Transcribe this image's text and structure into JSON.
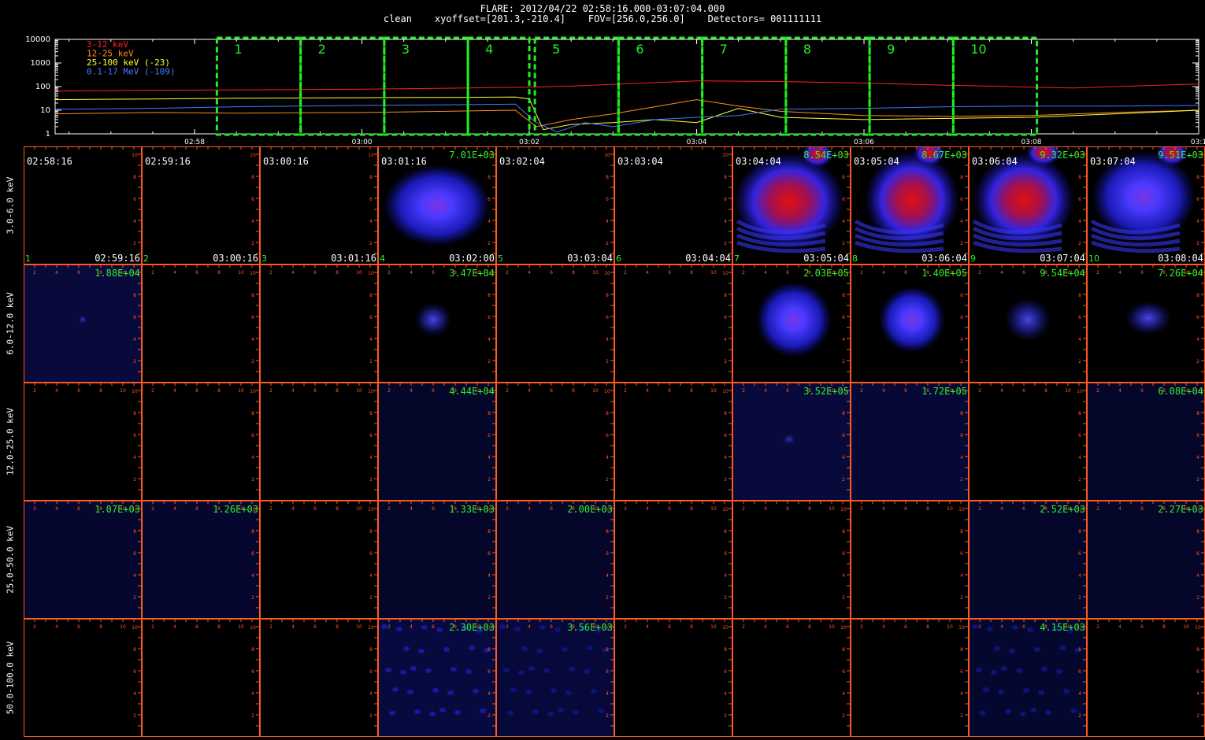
{
  "header": {
    "line1": "FLARE: 2012/04/22 02:58:16.000-03:07:04.000",
    "line2": "clean    xyoffset=[201.3,-210.4]    FOV=[256.0,256.0]    Detectors= 001111111"
  },
  "colors": {
    "frame": "#ff5a1e",
    "label_green": "#2cf02c",
    "box_green": "#22ee22",
    "s_3_12": "#ff2020",
    "s_12_25": "#ff8c1a",
    "s_25_100": "#ffff30",
    "s_01_17": "#3d7bff"
  },
  "chart_data": [
    {
      "type": "line",
      "ylim": [
        1,
        10000
      ],
      "yscale": "log",
      "yticks": [
        "10000",
        "1000",
        "100",
        "10",
        "1"
      ],
      "xlim": [
        "02:56:20",
        "03:10:00"
      ],
      "xticks": [
        "02:58",
        "03:00",
        "03:02",
        "03:04",
        "03:06",
        "03:08",
        "03:1"
      ],
      "legend_position": "top-left",
      "series": [
        {
          "name": "3-12 keV",
          "color": "#ff2020",
          "x": [
            "02:56:20",
            "02:57:30",
            "02:58:30",
            "03:00:00",
            "03:01:00",
            "03:02:00",
            "03:02:30",
            "03:03:00",
            "03:04:00",
            "03:05:00",
            "03:06:00",
            "03:07:00",
            "03:08:00",
            "03:08:30",
            "03:09:00",
            "03:10:00"
          ],
          "y": [
            65,
            70,
            72,
            78,
            85,
            95,
            105,
            125,
            175,
            165,
            140,
            115,
            95,
            88,
            100,
            130
          ]
        },
        {
          "name": "12-25 keV",
          "color": "#ff8c1a",
          "x": [
            "02:56:20",
            "02:57:30",
            "02:58:30",
            "03:00:00",
            "03:01:00",
            "03:01:50",
            "03:02:05",
            "03:02:30",
            "03:03:00",
            "03:03:30",
            "03:04:00",
            "03:04:30",
            "03:05:00",
            "03:06:00",
            "03:07:00",
            "03:08:00",
            "03:09:00",
            "03:10:00"
          ],
          "y": [
            7,
            8,
            7.5,
            8,
            9,
            10,
            2,
            4,
            7,
            14,
            28,
            15,
            9,
            6,
            5.5,
            6,
            8,
            10
          ]
        },
        {
          "name": "25-100 keV (-23)",
          "color": "#ffff30",
          "x": [
            "02:56:20",
            "02:57:30",
            "02:58:30",
            "03:00:00",
            "03:01:00",
            "03:01:50",
            "03:02:00",
            "03:02:10",
            "03:02:30",
            "03:03:00",
            "03:03:30",
            "03:04:00",
            "03:04:30",
            "03:05:00",
            "03:06:00",
            "03:07:00",
            "03:08:00",
            "03:09:00",
            "03:10:00"
          ],
          "y": [
            28,
            30,
            32,
            34,
            35,
            36,
            30,
            1.5,
            2.5,
            3,
            4,
            3,
            12,
            5,
            4,
            4.5,
            5,
            7,
            10
          ]
        },
        {
          "name": "0.1-17 MeV (-109)",
          "color": "#3d7bff",
          "x": [
            "02:56:20",
            "02:57:30",
            "02:58:30",
            "03:00:00",
            "03:01:00",
            "03:01:50",
            "03:02:05",
            "03:02:20",
            "03:02:40",
            "03:03:00",
            "03:03:30",
            "03:04:00",
            "03:04:30",
            "03:05:00",
            "03:06:00",
            "03:07:00",
            "03:08:00",
            "03:09:00",
            "03:10:00"
          ],
          "y": [
            11,
            12,
            14,
            16,
            17,
            18,
            3,
            1.2,
            3,
            2,
            4,
            5,
            6,
            11,
            12,
            14,
            15,
            15,
            16
          ]
        }
      ],
      "interval_boxes": [
        {
          "label": "1",
          "start": "02:58:16",
          "end": "02:59:16"
        },
        {
          "label": "2",
          "start": "02:59:16",
          "end": "03:00:16"
        },
        {
          "label": "3",
          "start": "03:00:16",
          "end": "03:01:16"
        },
        {
          "label": "4",
          "start": "03:01:16",
          "end": "03:02:00"
        },
        {
          "label": "5",
          "start": "03:02:04",
          "end": "03:03:04"
        },
        {
          "label": "6",
          "start": "03:03:04",
          "end": "03:04:04"
        },
        {
          "label": "7",
          "start": "03:04:04",
          "end": "03:05:04"
        },
        {
          "label": "8",
          "start": "03:05:04",
          "end": "03:06:04"
        },
        {
          "label": "9",
          "start": "03:06:04",
          "end": "03:07:04"
        },
        {
          "label": "10",
          "start": "03:07:04",
          "end": "03:08:04"
        }
      ]
    },
    {
      "type": "heatmap",
      "rows": [
        "3.0-6.0 keV",
        "6.0-12.0 keV",
        "12.0-25.0 keV",
        "25.0-50.0 keV",
        "50.0-100.0 keV"
      ],
      "columns": [
        {
          "index": "1",
          "start": "02:58:16",
          "end": "02:59:16"
        },
        {
          "index": "2",
          "start": "02:59:16",
          "end": "03:00:16"
        },
        {
          "index": "3",
          "start": "03:00:16",
          "end": "03:01:16"
        },
        {
          "index": "4",
          "start": "03:01:16",
          "end": "03:02:00"
        },
        {
          "index": "5",
          "start": "03:02:04",
          "end": "03:03:04"
        },
        {
          "index": "6",
          "start": "03:03:04",
          "end": "03:04:04"
        },
        {
          "index": "7",
          "start": "03:04:04",
          "end": "03:05:04"
        },
        {
          "index": "8",
          "start": "03:05:04",
          "end": "03:06:04"
        },
        {
          "index": "9",
          "start": "03:06:04",
          "end": "03:07:04"
        },
        {
          "index": "10",
          "start": "03:07:04",
          "end": "03:08:04"
        }
      ],
      "max_values": [
        [
          "",
          "",
          "",
          "7.01E+03",
          "",
          "",
          "8.54E+03",
          "8.67E+03",
          "9.32E+03",
          "9.51E+03"
        ],
        [
          "1.88E+04",
          "",
          "",
          "3.47E+04",
          "",
          "",
          "2.03E+05",
          "1.40E+05",
          "9.54E+04",
          "7.26E+04"
        ],
        [
          "",
          "",
          "",
          "4.44E+04",
          "",
          "",
          "3.52E+05",
          "1.72E+05",
          "",
          "6.08E+04"
        ],
        [
          "1.07E+03",
          "1.26E+03",
          "",
          "1.33E+03",
          "2.00E+03",
          "",
          "",
          "",
          "2.52E+03",
          "2.27E+03"
        ],
        [
          "",
          "",
          "",
          "2.30E+03",
          "3.56E+03",
          "",
          "",
          "",
          "4.15E+03",
          ""
        ]
      ],
      "axis_ticks": [
        "2",
        "4",
        "6",
        "8",
        "10"
      ]
    }
  ]
}
